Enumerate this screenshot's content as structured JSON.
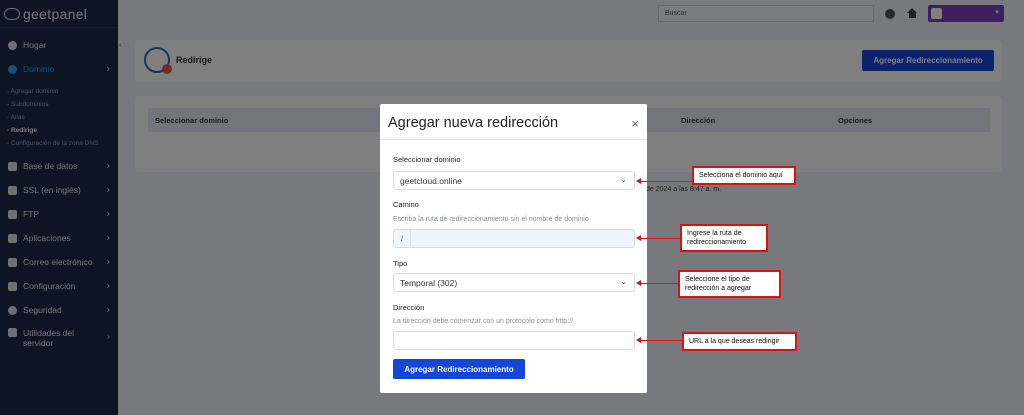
{
  "brand": {
    "name": "geetpanel"
  },
  "sidebar": {
    "items": [
      {
        "label": "Hogar",
        "icon": "dashboard-icon"
      },
      {
        "label": "Dominio",
        "icon": "globe-icon",
        "active": true
      },
      {
        "label": "Base de datos",
        "icon": "database-icon"
      },
      {
        "label": "SSL (en inglés)",
        "icon": "lock-icon"
      },
      {
        "label": "FTP",
        "icon": "folder-icon"
      },
      {
        "label": "Aplicaciones",
        "icon": "grid-icon"
      },
      {
        "label": "Correo electrónico",
        "icon": "envelope-icon"
      },
      {
        "label": "Configuración",
        "icon": "gears-icon"
      },
      {
        "label": "Seguridad",
        "icon": "shield-icon"
      },
      {
        "label": "Utilidades del servidor",
        "icon": "wrench-icon"
      }
    ],
    "subitems": [
      {
        "label": "- Agregar dominio"
      },
      {
        "label": "- Subdominios"
      },
      {
        "label": "- Alias"
      },
      {
        "label": "- Redirige",
        "active": true
      },
      {
        "label": "- Configuración de la zona DNS"
      }
    ]
  },
  "topbar": {
    "search_placeholder": "Buscar"
  },
  "page": {
    "title": "Redirige",
    "add_button": "Agregar Redireccionamiento",
    "table_headers": [
      "Seleccionar dominio",
      "Dirección",
      "Opciones"
    ],
    "footer_fragment": "de 2024 a las 8:47 a. m."
  },
  "modal": {
    "title": "Agregar nueva redirección",
    "close": "×",
    "domain_label": "Seleccionar dominio",
    "domain_value": "geetcloud.online",
    "path_label": "Camino",
    "path_hint": "Escriba la ruta de redireccionamiento sin el nombre de dominio",
    "path_prefix": "/",
    "type_label": "Tipo",
    "type_value": "Temporal (302)",
    "direction_label": "Dirección",
    "direction_hint": "La dirección debe comenzar con un protocolo como http://",
    "submit": "Agregar Redireccionamiento"
  },
  "annotations": {
    "domain": "Selecciona el dominio aquí",
    "path": "Ingrese la ruta de redireccionamiento",
    "type": "Seleccione el tipo de redirección a agregar",
    "url": "URL a la que deseas redirigir"
  },
  "colors": {
    "sidebar": "#1b2a4a",
    "primary": "#1446d8",
    "active_nav": "#2ea3f2",
    "user_menu": "#7b3fbf",
    "annotation": "#dd1111"
  }
}
